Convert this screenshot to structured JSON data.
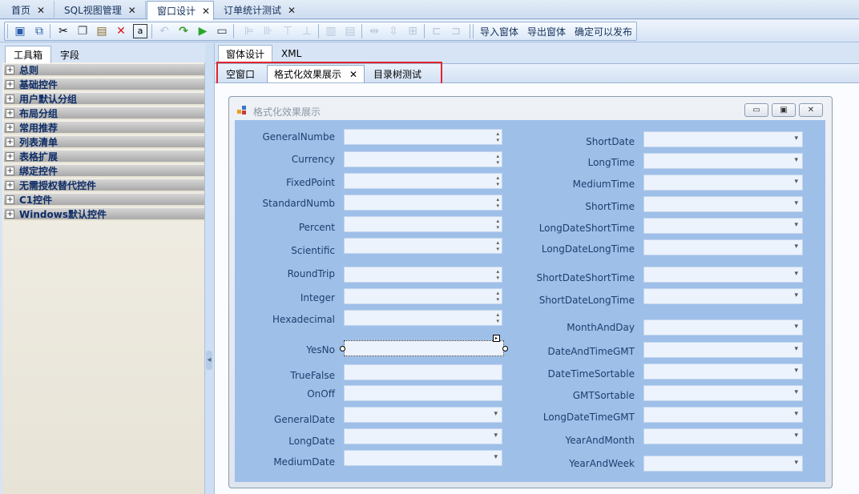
{
  "doc_tabs": [
    {
      "label": "首页",
      "closable": true
    },
    {
      "label": "SQL视图管理",
      "closable": true
    },
    {
      "label": "窗口设计",
      "closable": true,
      "active": true
    },
    {
      "label": "订单统计测试",
      "closable": true
    }
  ],
  "toolbar": {
    "import_label": "导入窗体",
    "export_label": "导出窗体",
    "publish_label": "确定可以发布",
    "icons": [
      "save-icon",
      "save-all-icon",
      "cut-icon",
      "copy-icon",
      "paste-icon",
      "delete-icon",
      "rename-icon",
      "undo-icon",
      "redo-icon",
      "run-icon",
      "form-icon",
      "align-left-icon",
      "align-center-icon",
      "align-top-icon",
      "align-middle-icon",
      "same-width-icon",
      "same-height-icon",
      "h-spacing-icon",
      "v-spacing-icon",
      "grid-icon",
      "send-back-icon",
      "bring-front-icon"
    ]
  },
  "left_panel": {
    "tabs": [
      "工具箱",
      "字段"
    ],
    "groups": [
      "总则",
      "基础控件",
      "用户默认分组",
      "布局分组",
      "常用推荐",
      "列表清单",
      "表格扩展",
      "绑定控件",
      "无需授权替代控件",
      "C1控件",
      "Windows默认控件"
    ]
  },
  "designer_tabs": [
    "窗体设计",
    "XML"
  ],
  "form_tabs": [
    "空窗口",
    "格式化效果展示",
    "目录树测试"
  ],
  "form": {
    "title": "格式化效果展示",
    "left_fields": [
      {
        "label": "GeneralNumbe",
        "kind": "spin"
      },
      {
        "label": "Currency",
        "kind": "spin"
      },
      {
        "label": "FixedPoint",
        "kind": "spin"
      },
      {
        "label": "StandardNumb",
        "kind": "spin"
      },
      {
        "label": "Percent",
        "kind": "spin"
      },
      {
        "label": "Scientific",
        "kind": "spin"
      },
      {
        "label": "RoundTrip",
        "kind": "spin"
      },
      {
        "label": "Integer",
        "kind": "spin"
      },
      {
        "label": "Hexadecimal",
        "kind": "spin"
      },
      {
        "label": "YesNo",
        "kind": "selected"
      },
      {
        "label": "TrueFalse",
        "kind": "text"
      },
      {
        "label": "OnOff",
        "kind": "text"
      },
      {
        "label": "GeneralDate",
        "kind": "drop"
      },
      {
        "label": "LongDate",
        "kind": "drop"
      },
      {
        "label": "MediumDate",
        "kind": "drop"
      }
    ],
    "right_fields": [
      {
        "label": "ShortDate"
      },
      {
        "label": "LongTime"
      },
      {
        "label": "MediumTime"
      },
      {
        "label": "ShortTime"
      },
      {
        "label": "LongDateShortTime"
      },
      {
        "label": "LongDateLongTime"
      },
      {
        "label": "ShortDateShortTime"
      },
      {
        "label": "ShortDateLongTime"
      },
      {
        "label": "MonthAndDay"
      },
      {
        "label": "DateAndTimeGMT"
      },
      {
        "label": "DateTimeSortable"
      },
      {
        "label": "GMTSortable"
      },
      {
        "label": "LongDateTimeGMT"
      },
      {
        "label": "YearAndMonth"
      },
      {
        "label": "YearAndWeek"
      }
    ]
  }
}
